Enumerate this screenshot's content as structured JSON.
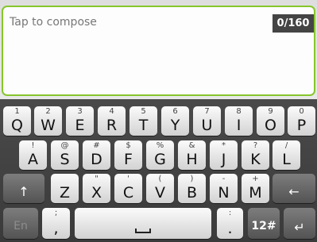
{
  "compose": {
    "placeholder": "Tap to compose",
    "counter": "0/160"
  },
  "keyboard": {
    "row1": [
      {
        "hint": "1",
        "label": "Q"
      },
      {
        "hint": "2",
        "label": "W"
      },
      {
        "hint": "3",
        "label": "E"
      },
      {
        "hint": "4",
        "label": "R"
      },
      {
        "hint": "5",
        "label": "T"
      },
      {
        "hint": "6",
        "label": "Y"
      },
      {
        "hint": "7",
        "label": "U"
      },
      {
        "hint": "8",
        "label": "I"
      },
      {
        "hint": "9",
        "label": "O"
      },
      {
        "hint": "0",
        "label": "P"
      }
    ],
    "row2": [
      {
        "hint": "!",
        "label": "A"
      },
      {
        "hint": "@",
        "label": "S"
      },
      {
        "hint": "#",
        "label": "D"
      },
      {
        "hint": "$",
        "label": "F"
      },
      {
        "hint": "%",
        "label": "G"
      },
      {
        "hint": "&",
        "label": "H"
      },
      {
        "hint": "*",
        "label": "J"
      },
      {
        "hint": "?",
        "label": "K"
      },
      {
        "hint": "/",
        "label": "L"
      }
    ],
    "row3": [
      {
        "hint": "",
        "label": "Z"
      },
      {
        "hint": "\"",
        "label": "X"
      },
      {
        "hint": "'",
        "label": "C"
      },
      {
        "hint": "(",
        "label": "V"
      },
      {
        "hint": ")",
        "label": "B"
      },
      {
        "hint": "-",
        "label": "N"
      },
      {
        "hint": "+",
        "label": "M"
      }
    ],
    "shift_icon": "↑",
    "backspace_icon": "←",
    "lang_label": "En",
    "comma_label": ",",
    "comma_hint": ";",
    "period_label": ".",
    "period_hint": ":",
    "symbols_label": "12#",
    "enter_icon": "↵"
  },
  "colors": {
    "accent_border": "#86c62b",
    "keyboard_bg": "#3f3f3f",
    "counter_bg": "#444444"
  }
}
